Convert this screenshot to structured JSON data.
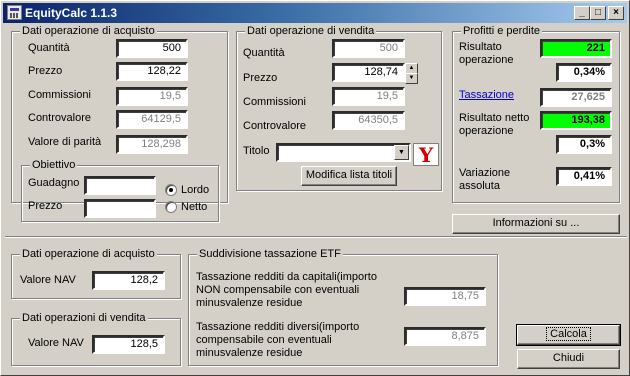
{
  "window": {
    "title": "EquityCalc 1.1.3"
  },
  "acquisto": {
    "title": "Dati operazione di acquisto",
    "quantita_label": "Quantità",
    "quantita": "500",
    "prezzo_label": "Prezzo",
    "prezzo": "128,22",
    "commissioni_label": "Commissioni",
    "commissioni": "19,5",
    "controvalore_label": "Controvalore",
    "controvalore": "64129,5",
    "parita_label": "Valore di parità",
    "parita": "128,298",
    "obiettivo": {
      "title": "Obiettivo",
      "guadagno_label": "Guadagno",
      "guadagno": "",
      "prezzo_label": "Prezzo",
      "prezzo": "",
      "lordo_label": "Lordo",
      "netto_label": "Netto",
      "selected": "Lordo"
    }
  },
  "vendita": {
    "title": "Dati operazione di vendita",
    "quantita_label": "Quantità",
    "quantita": "500",
    "prezzo_label": "Prezzo",
    "prezzo": "128,74",
    "commissioni_label": "Commissioni",
    "commissioni": "19,5",
    "controvalore_label": "Controvalore",
    "controvalore": "64350,5",
    "titolo_label": "Titolo",
    "titolo": "",
    "modifica_label": "Modifica lista titoli"
  },
  "profitti": {
    "title": "Profitti e perdite",
    "risultato_label": "Risultato operazione",
    "risultato": "221",
    "risultato_pct": "0,34%",
    "tassazione_label": "Tassazione",
    "tassazione": "27,625",
    "netto_label": "Risultato netto operazione",
    "netto": "193,38",
    "netto_pct": "0,3%",
    "variazione_label": "Variazione assoluta",
    "variazione": "0,41%"
  },
  "info_label": "Informazioni su ...",
  "etf_acquisto": {
    "title": "Dati operazione di acquisto",
    "nav_label": "Valore NAV",
    "nav": "128,2"
  },
  "etf_vendita": {
    "title": "Dati operazioni di vendita",
    "nav_label": "Valore NAV",
    "nav": "128,5"
  },
  "etf_tax": {
    "title": "Suddivisione tassazione ETF",
    "capitali_label": "Tassazione redditi da capitali(importo NON compensabile con eventuali minusvalenze residue",
    "capitali": "18,75",
    "diversi_label": "Tassazione redditi diversi(importo compensabile con eventuali minusvalenze residue",
    "diversi": "8,875"
  },
  "calcola_label": "Calcola",
  "chiudi_label": "Chiudi",
  "colors": {
    "titlebar": "#0a246a",
    "highlight": "#00ff00",
    "link": "#0000cc"
  }
}
